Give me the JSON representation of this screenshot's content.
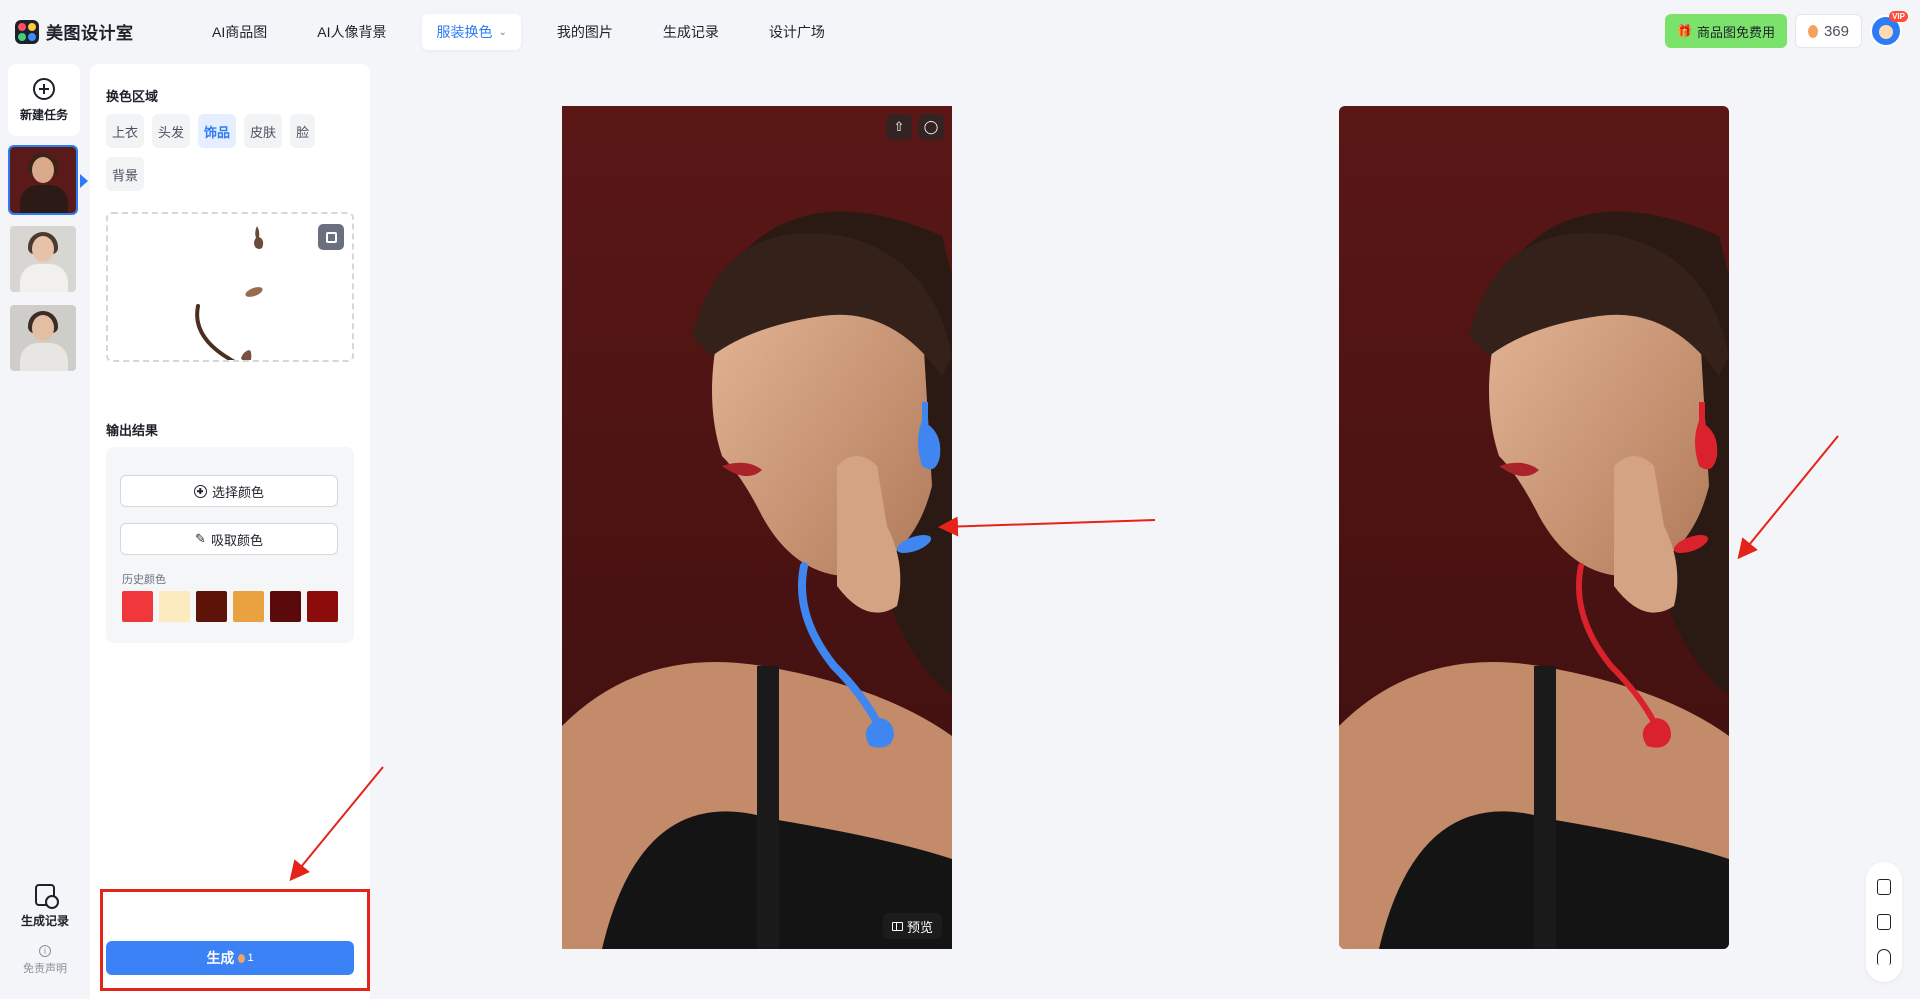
{
  "brand": {
    "name": "美图设计室"
  },
  "nav": {
    "items": [
      {
        "label": "AI商品图"
      },
      {
        "label": "AI人像背景"
      },
      {
        "label": "服装换色",
        "active": true
      },
      {
        "label": "我的图片"
      },
      {
        "label": "生成记录"
      },
      {
        "label": "设计广场"
      }
    ]
  },
  "top_right": {
    "free_label": "商品图免费用",
    "credits": "369",
    "vip_badge": "VIP"
  },
  "rail": {
    "new_task_label": "新建任务",
    "history_label": "生成记录",
    "disclaimer_label": "免责声明"
  },
  "panel": {
    "region_title": "换色区域",
    "regions": [
      {
        "label": "上衣"
      },
      {
        "label": "头发"
      },
      {
        "label": "饰品",
        "active": true
      },
      {
        "label": "皮肤"
      },
      {
        "label": "脸"
      },
      {
        "label": "背景"
      }
    ],
    "output_title": "输出结果",
    "pick_color_label": "选择颜色",
    "absorb_color_label": "吸取颜色",
    "history_colors_label": "历史颜色",
    "history_colors": [
      "#f0373b",
      "#fdebc0",
      "#5e1309",
      "#e9a23f",
      "#5b0a0c",
      "#8c0b0b"
    ]
  },
  "generate": {
    "label": "生成",
    "cost": "1"
  },
  "preview": {
    "label": "预览"
  },
  "colors": {
    "accent": "#2e7bf6",
    "mask_blue": "#3f86f0",
    "jewelry_red": "#d9222b",
    "annotation_red": "#e52318"
  }
}
